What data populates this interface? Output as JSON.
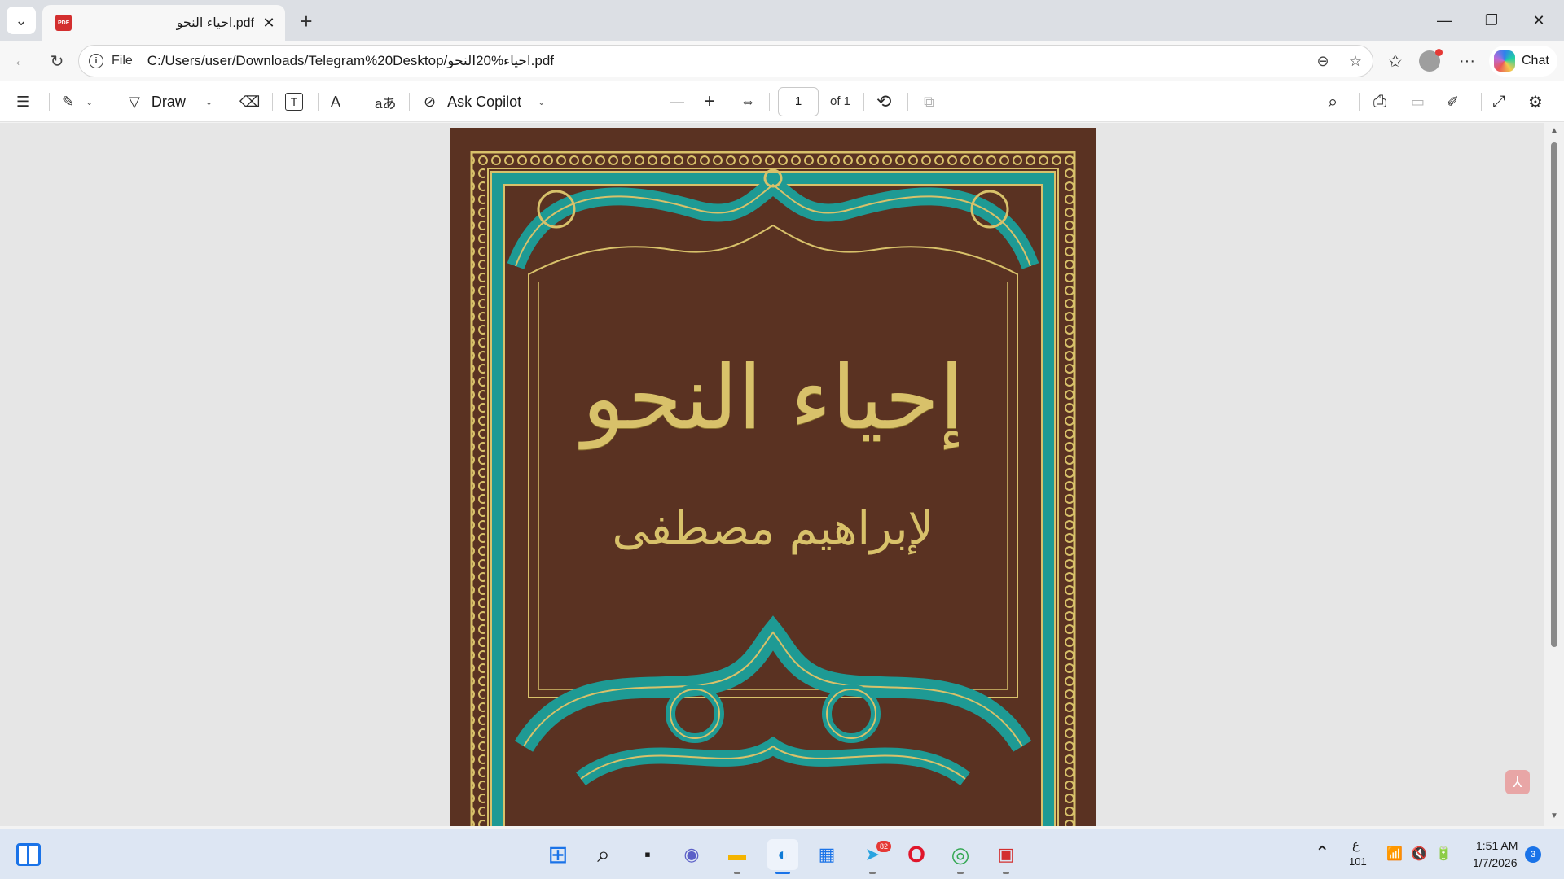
{
  "window": {
    "minimize_glyph": "—",
    "restore_glyph": "❐",
    "close_glyph": "✕"
  },
  "tab": {
    "title": "احياء النحو.pdf",
    "favicon_label": "PDF",
    "close_glyph": "✕",
    "new_tab_glyph": "+",
    "menu_glyph": "⌄"
  },
  "address_bar": {
    "scheme_label": "File",
    "url": "C:/Users/user/Downloads/Telegram%20Desktop/احياء%20النحو.pdf",
    "back_glyph": "←",
    "reload_glyph": "↻",
    "info_glyph": "i",
    "zoom_glyph": "⊖",
    "favorite_glyph": "☆",
    "favorites_glyph": "✩",
    "more_glyph": "···",
    "chat_label": "Chat"
  },
  "pdf_toolbar": {
    "contents_glyph": "☰",
    "highlight_glyph": "✎",
    "draw_label": "Draw",
    "draw_glyph": "▽",
    "erase_glyph": "⌫",
    "text_glyph": "T",
    "read_aloud_glyph": "A",
    "translate_glyph": "aあ",
    "ask_copilot_label": "Ask Copilot",
    "ask_copilot_glyph": "⊘",
    "zoom_out_glyph": "—",
    "zoom_in_glyph": "+",
    "fit_glyph": "⇔",
    "page_current": "1",
    "page_total": "of 1",
    "rotate_glyph": "⟲",
    "two_page_glyph": "⧉",
    "search_glyph": "⌕",
    "print_glyph": "⎙",
    "save_glyph": "▭",
    "save_as_glyph": "✐",
    "fullscreen_glyph": "⤢",
    "settings_glyph": "⚙",
    "caret_glyph": "⌄"
  },
  "document": {
    "cover_title": "إحياء النحو",
    "cover_author": "لإبراهيم مصطفى",
    "colors": {
      "leather": "#5a3222",
      "gold": "#d8c16a",
      "teal": "#1e9a94"
    }
  },
  "scrollbar": {
    "up_glyph": "▲",
    "down_glyph": "▼"
  },
  "acrobat_glyph": "⅄",
  "taskbar": {
    "apps": [
      {
        "name": "windows-start-icon",
        "glyph": "⊞",
        "color": "#1a73e8"
      },
      {
        "name": "search-icon",
        "glyph": "⌕",
        "color": "#1b1b1b"
      },
      {
        "name": "task-view-icon",
        "glyph": "▪",
        "color": "#1b1b1b"
      },
      {
        "name": "chat-app-icon",
        "glyph": "◉",
        "color": "#5b5fc7"
      },
      {
        "name": "file-explorer-icon",
        "glyph": "▬",
        "color": "#f4b400"
      },
      {
        "name": "edge-icon",
        "glyph": "◐",
        "color": "#0f7ad6"
      },
      {
        "name": "store-icon",
        "glyph": "▦",
        "color": "#1a73e8"
      },
      {
        "name": "telegram-icon",
        "glyph": "➤",
        "color": "#2aa3e0"
      },
      {
        "name": "opera-icon",
        "glyph": "O",
        "color": "#e0162b"
      },
      {
        "name": "chrome-icon",
        "glyph": "◎",
        "color": "#34a853"
      },
      {
        "name": "pdf-app-icon",
        "glyph": "▣",
        "color": "#d32f2f"
      }
    ],
    "telegram_badge": "82",
    "tray": {
      "chevron_glyph": "⌃",
      "ime_top": "ع",
      "ime_bottom": "101",
      "wifi_glyph": "📶",
      "volume_glyph": "🔇",
      "battery_glyph": "🔋",
      "time": "1:51 AM",
      "date": "1/7/2026",
      "notification_count": "3"
    }
  }
}
